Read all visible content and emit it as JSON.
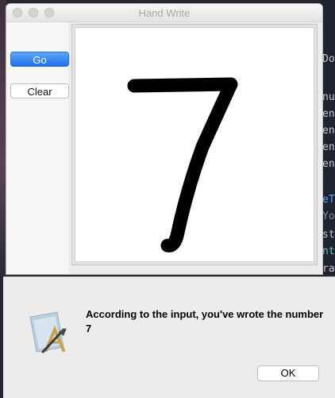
{
  "window": {
    "title": "Hand Write"
  },
  "sidebar": {
    "go_label": "Go",
    "clear_label": "Clear"
  },
  "canvas": {
    "drawn_digit": "7"
  },
  "alert": {
    "message": "According to the input, you've wrote the number 7",
    "ok_label": "OK"
  },
  "background_editor": {
    "lines": [
      "Dow",
      "nu",
      "ens",
      "ens",
      "ens",
      "ens",
      "eT",
      "You",
      "st",
      "nt",
      "ra"
    ]
  }
}
